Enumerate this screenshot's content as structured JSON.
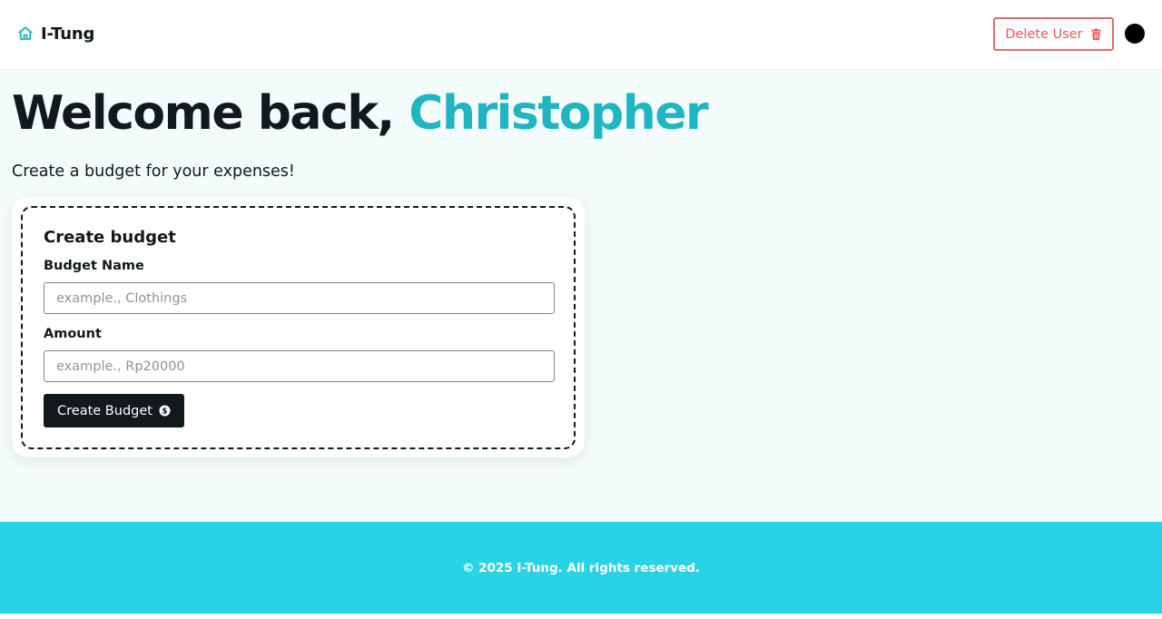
{
  "header": {
    "brand_name": "I-Tung",
    "brand_icon": "home-icon",
    "delete_label": "Delete User",
    "delete_icon": "trash-icon",
    "accent_color": "#1fb6c1",
    "danger_color": "#e05c5c"
  },
  "main": {
    "welcome_prefix": "Welcome back, ",
    "user_name": "Christopher",
    "subtitle": "Create a budget for your expenses!"
  },
  "form": {
    "title": "Create budget",
    "name_label": "Budget Name",
    "name_placeholder": "example., Clothings",
    "name_value": "",
    "amount_label": "Amount",
    "amount_placeholder": "example., Rp20000",
    "amount_value": "",
    "submit_label": "Create Budget",
    "submit_icon": "dollar-circle-icon"
  },
  "footer": {
    "text": "© 2025 I-Tung. All rights reserved.",
    "color": "#29d3e6"
  }
}
